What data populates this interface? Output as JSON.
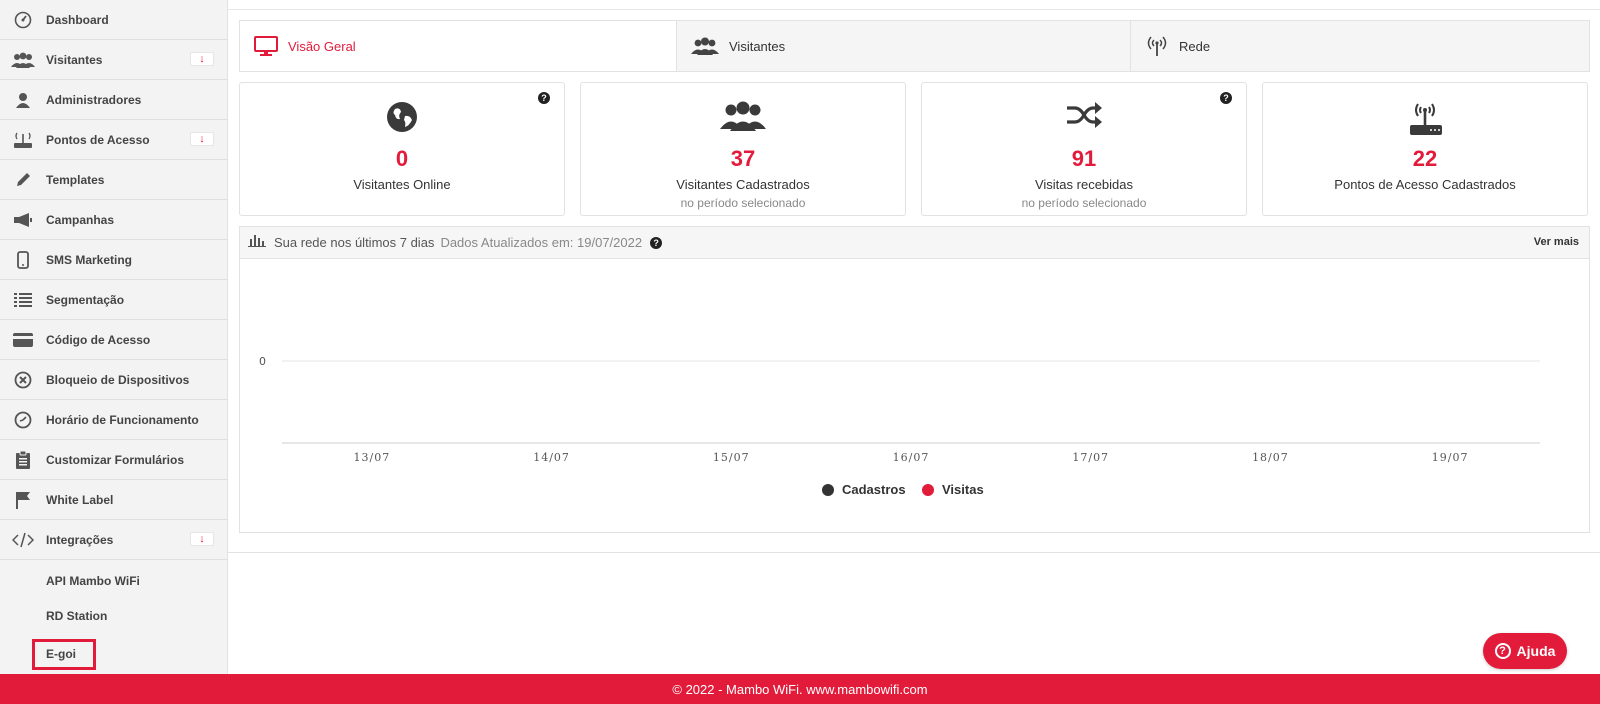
{
  "sidebar": {
    "items": [
      {
        "label": "Dashboard",
        "icon": "speedometer-icon"
      },
      {
        "label": "Visitantes",
        "icon": "users-icon",
        "expand": "↓"
      },
      {
        "label": "Administradores",
        "icon": "user-icon"
      },
      {
        "label": "Pontos de Acesso",
        "icon": "router-icon",
        "expand": "↓"
      },
      {
        "label": "Templates",
        "icon": "pencil-icon"
      },
      {
        "label": "Campanhas",
        "icon": "megaphone-icon"
      },
      {
        "label": "SMS Marketing",
        "icon": "phone-icon"
      },
      {
        "label": "Segmentação",
        "icon": "list-icon"
      },
      {
        "label": "Código de Acesso",
        "icon": "card-icon"
      },
      {
        "label": "Bloqueio de Dispositivos",
        "icon": "block-icon"
      },
      {
        "label": "Horário de Funcionamento",
        "icon": "clock-icon"
      },
      {
        "label": "Customizar Formulários",
        "icon": "clipboard-icon"
      },
      {
        "label": "White Label",
        "icon": "flag-icon"
      },
      {
        "label": "Integrações",
        "icon": "code-icon",
        "expand": "↓"
      }
    ],
    "subitems": [
      "API Mambo WiFi",
      "RD Station",
      "E-goi"
    ]
  },
  "tabs": [
    {
      "label": "Visão Geral",
      "icon": "monitor-icon"
    },
    {
      "label": "Visitantes",
      "icon": "users-icon"
    },
    {
      "label": "Rede",
      "icon": "signal-icon"
    }
  ],
  "cards": [
    {
      "value": "0",
      "label": "Visitantes Online",
      "sub": "",
      "icon": "globe-icon"
    },
    {
      "value": "37",
      "label": "Visitantes Cadastrados",
      "sub": "no período selecionado",
      "icon": "users-icon"
    },
    {
      "value": "91",
      "label": "Visitas recebidas",
      "sub": "no período selecionado",
      "icon": "shuffle-icon"
    },
    {
      "value": "22",
      "label": "Pontos de Acesso Cadastrados",
      "sub": "",
      "icon": "router-icon"
    }
  ],
  "help_mark": "?",
  "chart_panel": {
    "title": "Sua rede nos últimos 7 dias",
    "updated": "Dados Atualizados em: 19/07/2022",
    "more": "Ver mais"
  },
  "chart_data": {
    "type": "line",
    "x": [
      "13/07",
      "14/07",
      "15/07",
      "16/07",
      "17/07",
      "18/07",
      "19/07"
    ],
    "y_ticks": [
      "0"
    ],
    "series": [
      {
        "name": "Cadastros",
        "color": "#333333",
        "values": [
          0,
          0,
          0,
          0,
          0,
          0,
          0
        ]
      },
      {
        "name": "Visitas",
        "color": "#e31b3b",
        "values": [
          0,
          0,
          0,
          0,
          0,
          0,
          0
        ]
      }
    ],
    "grid": true,
    "legend": "bottom"
  },
  "help_button": "Ajuda",
  "footer": "© 2022 - Mambo WiFi. www.mambowifi.com",
  "colors": {
    "accent": "#e31b3b",
    "sidebar": "#f3f3f3"
  }
}
